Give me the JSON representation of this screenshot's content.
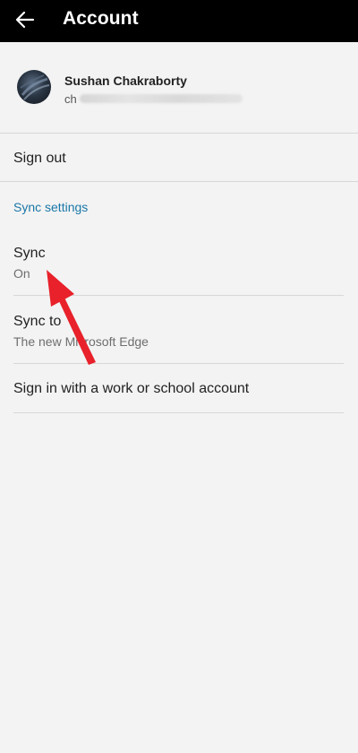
{
  "header": {
    "title": "Account",
    "back_icon": "back-arrow-icon",
    "background": "#000000",
    "text_color": "#ffffff"
  },
  "profile": {
    "name": "Sushan Chakraborty",
    "email_visible_prefix": "ch"
  },
  "actions": {
    "sign_out": "Sign out"
  },
  "sync_settings": {
    "section_title": "Sync settings",
    "section_color": "#1a77a8",
    "items": [
      {
        "label": "Sync",
        "sublabel": "On"
      },
      {
        "label": "Sync to",
        "sublabel": "The new Microsoft Edge"
      },
      {
        "label": "Sign in with a work or school account",
        "sublabel": ""
      }
    ]
  },
  "annotation": {
    "arrow_color": "#e8212b"
  }
}
